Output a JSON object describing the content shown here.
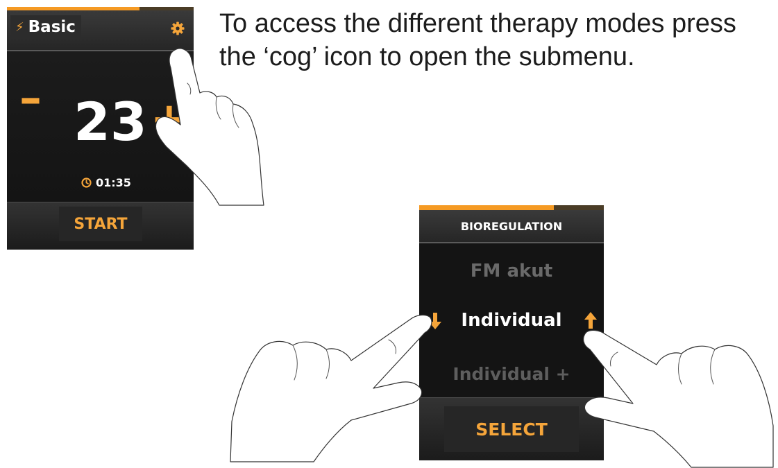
{
  "instruction": {
    "text": "To access the different therapy modes press the ‘cog’ icon to open the submenu."
  },
  "screen1": {
    "progress_fraction": 0.71,
    "bolt_icon": "bolt-icon",
    "title": "Basic",
    "cog_icon": "cog-icon",
    "minus_label": "–",
    "value": "23",
    "plus_label": "+",
    "timer_icon": "clock-icon",
    "timer": "01:35",
    "start_label": "START"
  },
  "screen2": {
    "progress_fraction": 0.73,
    "title": "BIOREGULATION",
    "items": [
      "FM akut",
      "Individual",
      "Individual +"
    ],
    "selected_index": 1,
    "down_arrow_icon": "arrow-down-icon",
    "up_arrow_icon": "arrow-up-icon",
    "select_label": "SELECT"
  },
  "colors": {
    "accent": "#f5a53a",
    "screen_bg": "#141414",
    "inactive_item": "#6a6a6a",
    "text_white": "#ffffff"
  }
}
